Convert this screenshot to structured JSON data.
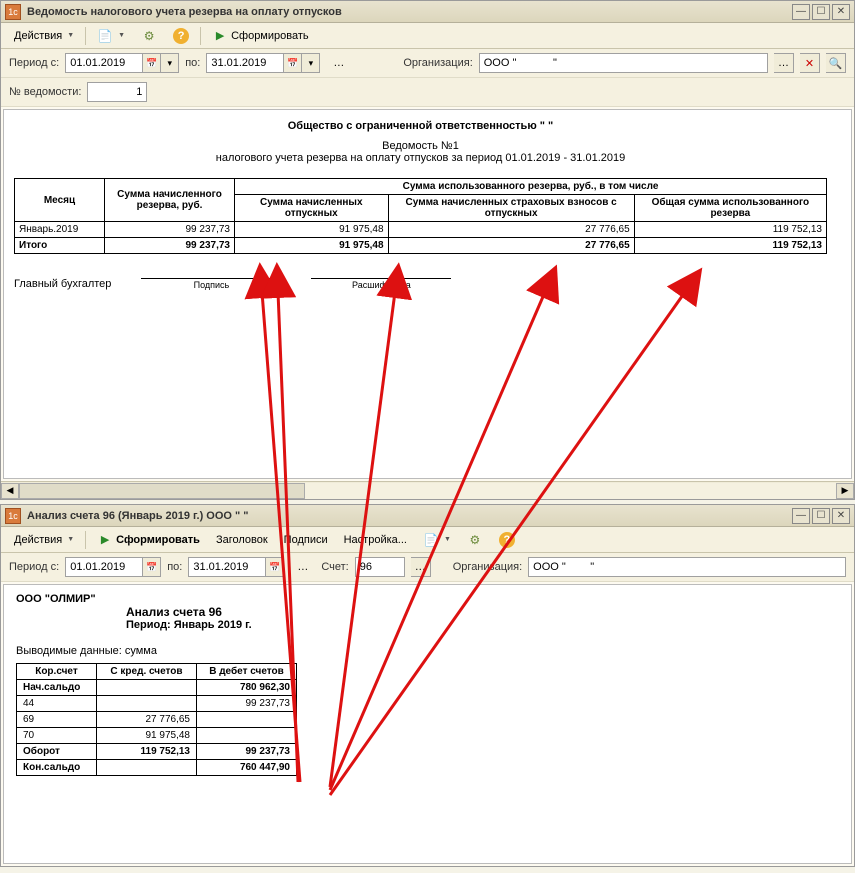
{
  "window1": {
    "title": "Ведомость налогового учета резерва на оплату отпусков",
    "toolbar": {
      "actions_label": "Действия",
      "generate_label": "Сформировать"
    },
    "params": {
      "period_from_label": "Период с:",
      "period_from": "01.01.2019",
      "period_to_label": "по:",
      "period_to": "31.01.2019",
      "org_label": "Организация:",
      "org_value": "ООО \"            \"",
      "vedomost_no_label": "№ ведомости:",
      "vedomost_no": "1"
    },
    "report": {
      "header": "Общество с ограниченной ответственностью \"           \"",
      "sub1": "Ведомость №1",
      "sub2": "налогового учета резерва на оплату отпусков за период 01.01.2019 - 31.01.2019",
      "col_month": "Месяц",
      "col_accrued": "Сумма начисленного резерва, руб.",
      "col_used_group": "Сумма использованного резерва, руб., в том числе",
      "col_vac": "Сумма начисленных отпускных",
      "col_ins": "Сумма начисленных страховых взносов с отпускных",
      "col_total_used": "Общая сумма использованного резерва",
      "rows": [
        {
          "month": "Январь.2019",
          "accrued": "99 237,73",
          "vac": "91 975,48",
          "ins": "27 776,65",
          "total": "119 752,13"
        }
      ],
      "total_label": "Итого",
      "totals": {
        "accrued": "99 237,73",
        "vac": "91 975,48",
        "ins": "27 776,65",
        "total": "119 752,13"
      },
      "chief_acc": "Главный бухгалтер",
      "sign_podpis": "Подпись",
      "sign_rasshifr": "Расшифровка"
    }
  },
  "window2": {
    "title": "Анализ счета 96 (Январь 2019 г.) ООО \"        \"",
    "toolbar": {
      "actions_label": "Действия",
      "generate_label": "Сформировать",
      "header_label": "Заголовок",
      "totals_label": "Подписи",
      "settings_label": "Настройка..."
    },
    "params": {
      "period_from_label": "Период с:",
      "period_from": "01.01.2019",
      "period_to_label": "по:",
      "period_to": "31.01.2019",
      "account_label": "Счет:",
      "account_value": "96",
      "org_label": "Организация:",
      "org_value": "ООО \"        \""
    },
    "report": {
      "org": "ООО \"ОЛМИР\"",
      "title": "Анализ счета 96",
      "period": "Период: Январь 2019 г.",
      "out_data": "Выводимые данные: сумма",
      "col_korr": "Кор.счет",
      "col_kred": "С кред. счетов",
      "col_debet": "В дебет счетов",
      "rows": [
        {
          "acc": "Нач.сальдо",
          "kred": "",
          "debet": "780 962,30",
          "bold": true
        },
        {
          "acc": "44",
          "kred": "",
          "debet": "99 237,73",
          "bold": false
        },
        {
          "acc": "69",
          "kred": "27 776,65",
          "debet": "",
          "bold": false
        },
        {
          "acc": "70",
          "kred": "91 975,48",
          "debet": "",
          "bold": false
        },
        {
          "acc": "Оборот",
          "kred": "119 752,13",
          "debet": "99 237,73",
          "bold": true
        },
        {
          "acc": "Кон.сальдо",
          "kred": "",
          "debet": "760 447,90",
          "bold": true
        }
      ]
    }
  }
}
